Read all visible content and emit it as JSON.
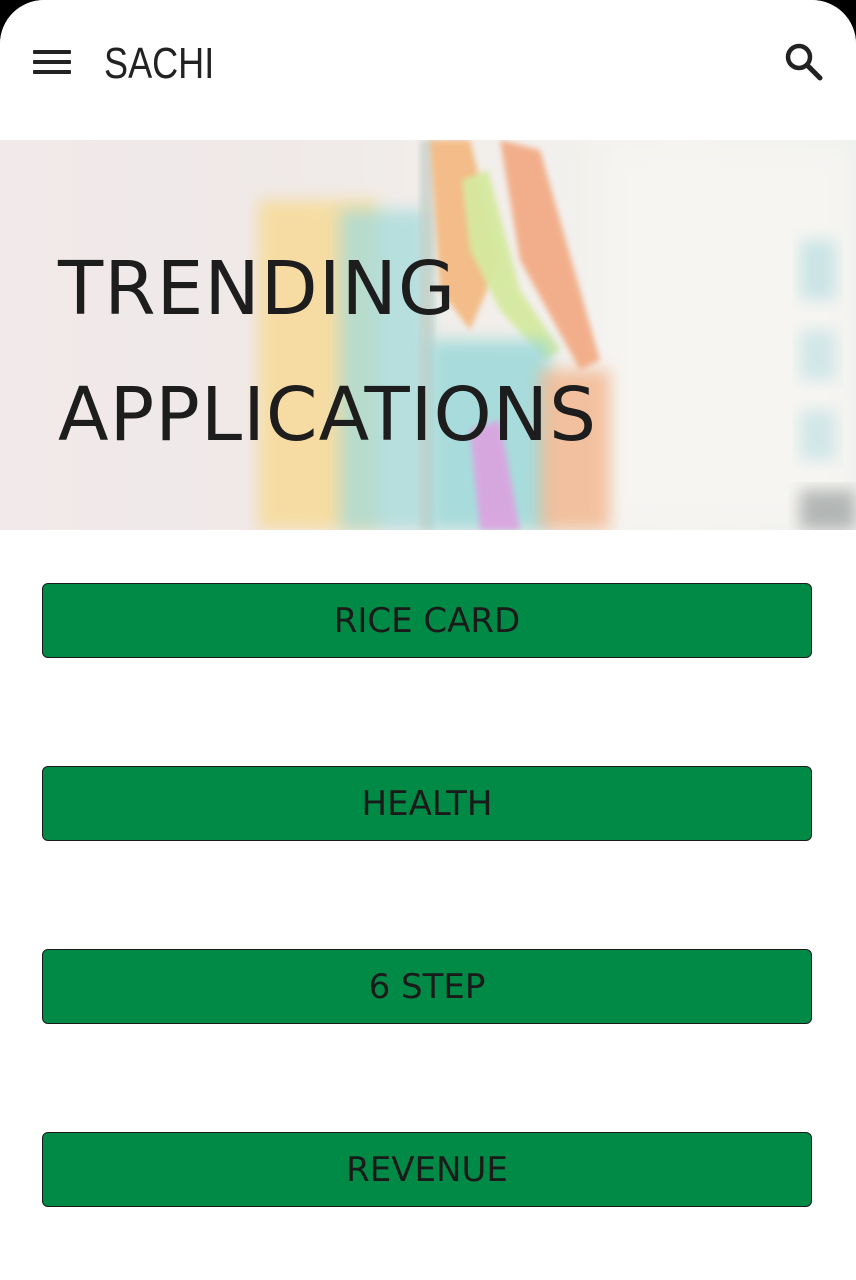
{
  "header": {
    "menu_icon": "hamburger-menu-icon",
    "title": "SACHI",
    "search_icon": "search-icon"
  },
  "hero": {
    "line1": "TRENDING",
    "line2": "APPLICATIONS"
  },
  "buttons": [
    {
      "label": "RICE CARD"
    },
    {
      "label": "HEALTH"
    },
    {
      "label": "6 STEP"
    },
    {
      "label": "REVENUE"
    }
  ],
  "colors": {
    "button_bg": "#008a45",
    "text": "#1a1a1a",
    "background": "#ffffff"
  }
}
